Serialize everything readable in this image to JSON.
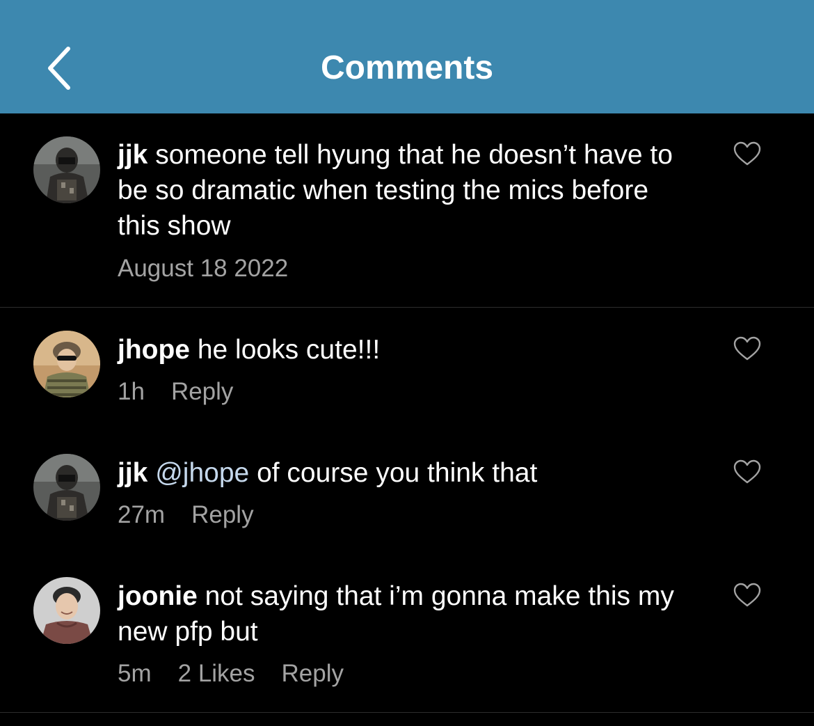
{
  "header": {
    "title": "Comments",
    "back_icon": "chevron-left-icon",
    "background": "#3d88af"
  },
  "caption": {
    "username": "jjk",
    "text": " someone tell hyung that he doesn’t have to be so dramatic when testing the mics before this show",
    "date": "August 18 2022"
  },
  "comments": [
    {
      "username": "jhope",
      "text": " he looks cute!!!",
      "time": "1h",
      "reply_label": "Reply"
    },
    {
      "username": "jjk",
      "mention": "@jhope",
      "text": " of course you think that",
      "time": "27m",
      "reply_label": "Reply"
    },
    {
      "username": "joonie",
      "text": " not saying that i’m gonna make this my new pfp but",
      "time": "5m",
      "likes": "2 Likes",
      "reply_label": "Reply"
    }
  ],
  "icons": {
    "like": "heart-outline-icon",
    "avatar": "user-avatar"
  },
  "colors": {
    "background": "#000000",
    "meta_text": "#a3a3a3",
    "mention": "#c5d8ec"
  }
}
